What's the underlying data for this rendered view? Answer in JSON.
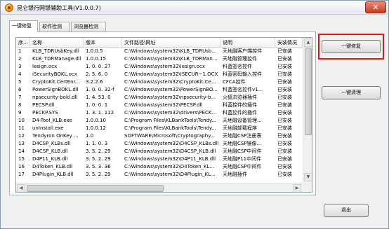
{
  "window": {
    "title": "昆仑银行网银辅助工具(V1.0.0.7)",
    "close_label": "✕"
  },
  "tabs": [
    {
      "label": "一键修复",
      "active": true
    },
    {
      "label": "软件检测",
      "active": false
    },
    {
      "label": "浏览器检测",
      "active": false
    }
  ],
  "table": {
    "columns": [
      "序...",
      "名称",
      "版本",
      "文件路径\\网址",
      "说明",
      "安装情况"
    ],
    "rows": [
      [
        "1",
        "KLB_TDRUsbKey.dll",
        "1.0.0.5",
        "C:\\Windows\\system32\\KLB_TDRUsb...",
        "天地融客户端控件",
        "已安装"
      ],
      [
        "2",
        "KLB_TDRManage.dll",
        "1.0.0.15",
        "C:\\Windows\\system32\\KLB_TDRMan...",
        "天地融管理控件",
        "已安装"
      ],
      [
        "3",
        "lesign.ocx",
        "1. 0. 0. 27",
        "C:\\Windows\\system32\\lesign.ocx",
        "科蓝签名控件",
        "已安装"
      ],
      [
        "4",
        "iSecurityBOKL.ocx",
        "2. 5. 6. 0",
        "C:\\Windows\\system32\\ISECUR~1.OCX",
        "科蓝密码输入控件",
        "已安装"
      ],
      [
        "5",
        "CryptoKit.CertEnr...",
        "3.2.2.6",
        "C:\\Windows\\system32\\CryptoKit.Ce...",
        "CFCA控件",
        "已安装"
      ],
      [
        "6",
        "PowerSignBOKL.dll",
        "1. 0. 0. 32-f",
        "C:\\Windows\\system32\\PowerSignBO...",
        "科蓝签名控件v1...",
        "已安装"
      ],
      [
        "7",
        "npsecurity-bokl.dll",
        "1. 4. 53. 0",
        "C:\\Windows\\system32\\npsecurity-b...",
        "火狐浏览器插件",
        "已安装"
      ],
      [
        "8",
        "PECSP.dll",
        "1. 0. 0. 1",
        "C:\\Windows\\system32\\PECSP.dll",
        "科蓝控件的插件",
        "已安装"
      ],
      [
        "9",
        "PECKP.SYS",
        "1. 3. 1. 112",
        "C:\\Windows\\system32\\drivers\\PECK...",
        "科蓝控件的插件",
        "已安装"
      ],
      [
        "10",
        "D4-Tool_KLB.exe",
        "1.0.0.10",
        "C:\\Program Files\\KLBankTools\\Tendy...",
        "天地融设备管理...",
        "已安装"
      ],
      [
        "11",
        "unInstall.exe",
        "1.0.0.12",
        "C:\\Program Files\\KLBankTools\\Tendy...",
        "天地融卸载程序",
        "已安装"
      ],
      [
        "12",
        "Tendyron OnKey ...",
        "1.0",
        "SOFTWARE\\Microsoft\\Cryptography...",
        "天地融CSP注册表",
        "已安装"
      ],
      [
        "13",
        "D4CSP_KLBs.dll",
        "1. 1. 0. 3",
        "C:\\Windows\\system32\\D4CSP_KLBs.dll",
        "天地融CSP镜像...",
        "已安装"
      ],
      [
        "14",
        "D4CSP_KLB.dll",
        "3. 5. 2. 29",
        "C:\\Windows\\system32\\D4CSP_KLB.dll",
        "天地融CSP中间件",
        "已安装"
      ],
      [
        "15",
        "D4P11_KLB.dll",
        "3. 5. 2. 29",
        "C:\\Windows\\system32\\D4P11_KLB.dll",
        "天地融P11中间件",
        "已安装"
      ],
      [
        "16",
        "D4Token_KLB.dll",
        "3. 5. 3. 36",
        "C:\\Windows\\system32\\D4Token_KL...",
        "天地融CSP中间件",
        "已安装"
      ],
      [
        "17",
        "D4Plugin_KLB.dll",
        "3. 5. 2. 29",
        "C:\\Windows\\system32\\D4Plugin_KL...",
        "天地融插件",
        "已安装"
      ]
    ]
  },
  "buttons": {
    "repair": "一键修复",
    "clean": "一键清理",
    "exit": "退出"
  }
}
